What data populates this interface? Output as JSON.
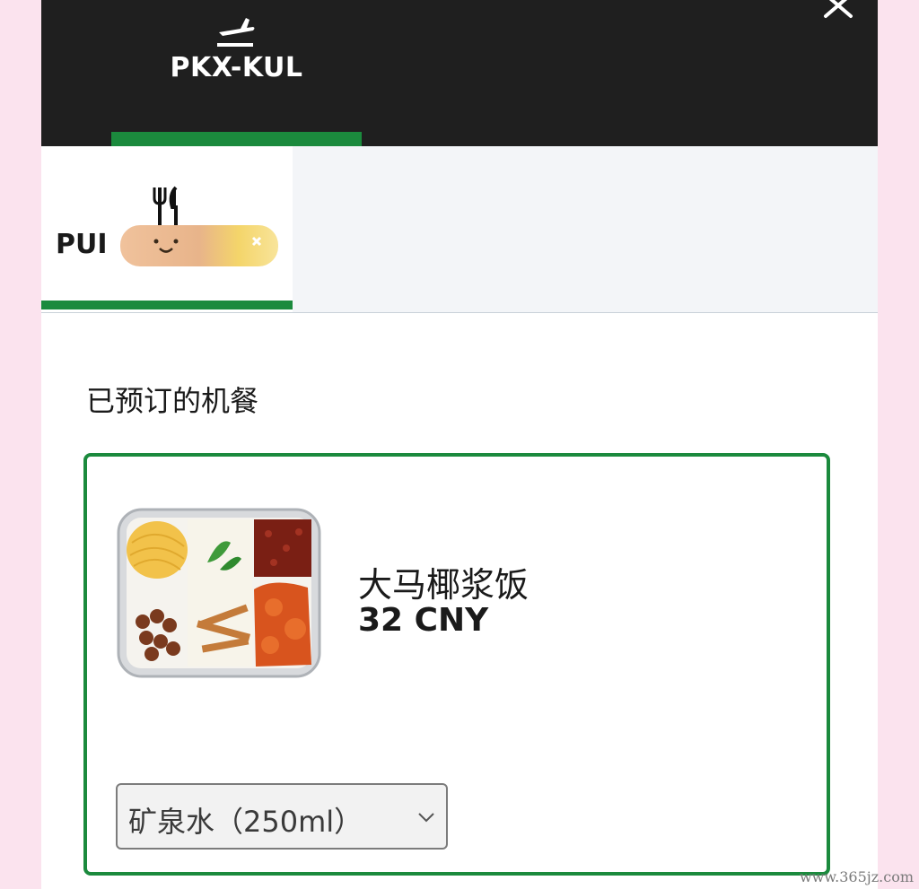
{
  "header": {
    "route": "PKX-KUL",
    "icons": {
      "flight": "plane-takeoff-icon",
      "close": "close-icon"
    }
  },
  "passenger_tab": {
    "label_visible": "PUI",
    "icon": "fork-knife-icon"
  },
  "section": {
    "title": "已预订的机餐"
  },
  "meal": {
    "name": "大马椰浆饭",
    "price": "32 CNY",
    "image": "nasi-lemak-meal-image"
  },
  "drink_select": {
    "selected": "矿泉水（250ml）",
    "icon": "chevron-down-icon"
  },
  "watermark": "www.365jz.com",
  "colors": {
    "accent": "#1b8a3d",
    "header_bg": "#1f1f1f",
    "page_bg": "#fbe3ee",
    "subnav_bg": "#f3f5f8"
  }
}
